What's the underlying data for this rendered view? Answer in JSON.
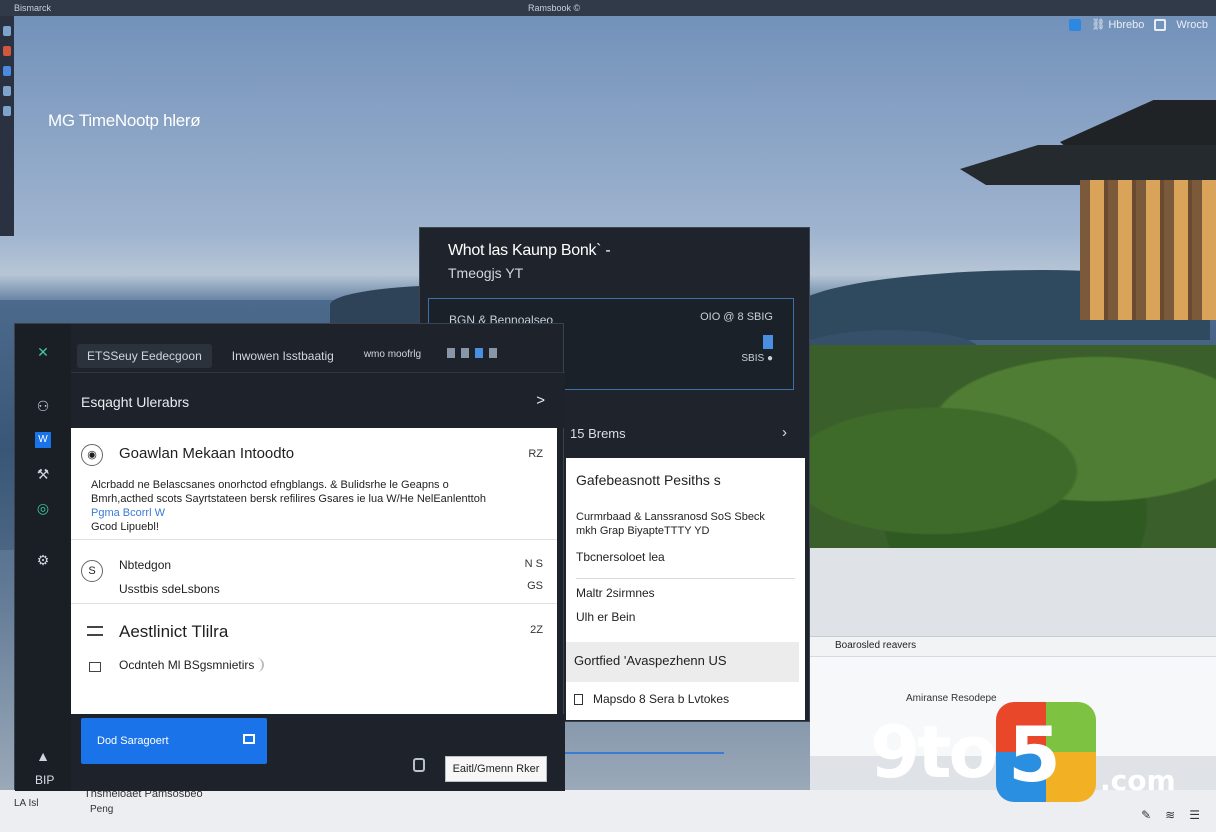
{
  "topbar": {
    "app_label": "Bismarck",
    "center_label": "Ramsbook  ©"
  },
  "tray": {
    "items": [
      "Hbrebo",
      "Wrocb"
    ]
  },
  "wallpaper": {
    "title": "MG TimeNootp hlerø"
  },
  "back_window": {
    "title": "Whot las Kaunp Bonk`  -",
    "subtitle": "Tmeogjs YT",
    "card": {
      "label": "BGN & Bennoalseo",
      "right_top": "OIO @ 8\nSBIG",
      "right_bottom": "SBIS ●"
    },
    "section": "15 Brems",
    "panel": {
      "heading": "Gafebeasnott Pesiths s",
      "desc": "Curmrbaad & Lanssranosd SoS Sbeck mkh Grap BiyapteTTTY YD",
      "tag": "Tbcnersoloet lea",
      "menu1": "Maltr 2sirmnes",
      "menu2": "Ulh er Bein",
      "highlight": "Gortfied 'Avaspezhenn US",
      "last": "Mapsdo 8 Sera b Lvtokes"
    }
  },
  "front_window": {
    "tabs": [
      "ETSSeuy Eedecgoon",
      "Inwowen Isstbaatig",
      "wmo moofrlg"
    ],
    "header": {
      "title": "Esqaght Ulerabrs",
      "chevron": ">"
    },
    "items": [
      {
        "title": "Goawlan Mekaan Intoodto",
        "num": "RZ",
        "desc1": "Alcrbadd ne Belascsanes onorhctod efngblangs. & Bulidsrhe le Geapns o",
        "desc2": "Bmrh,acthed scots Sayrtstateen bersk refilires Gsares ie lua W/He NelEanlenttoh",
        "desc3": "Pgma Bcorrl W",
        "desc4": "Gcod Lipuebl!"
      },
      {
        "title": "Nbtedgon",
        "sub": "Usstbis sdeLsbons",
        "num": "N S",
        "num2": "GS"
      },
      {
        "title": "Aestlinict Tlilra",
        "line": "Ocdnteh Ml BSgsmnietirs",
        "num": "2Z"
      }
    ],
    "primary_button": "Dod Saragoert",
    "secondary_button": "Eaitl/Gmenn Rker",
    "rail_bottom": "BIP"
  },
  "right_window": {
    "bar_label": "Boarosled reavers",
    "row_label": "Amiranse Resodepe"
  },
  "bottom": {
    "left_title": "Thsmeloaet Pamsosbeo",
    "left_sub": "Peng",
    "tab": "LA   Isl"
  },
  "watermark": {
    "text": "9to5",
    "suffix": ".com"
  }
}
